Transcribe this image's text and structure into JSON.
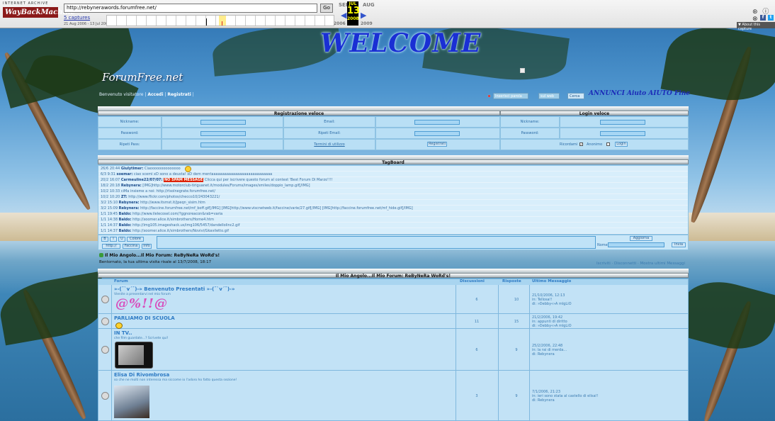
{
  "wayback": {
    "logo_top": "INTERNET ARCHIVE",
    "logo_main": "WayBackMachine",
    "url": "http://rebynerawords.forumfree.net/",
    "go": "Go",
    "captures": "5 captures",
    "date_range": "21 Aug 2006 - 13 Jul 2008",
    "month_prev": "SEP",
    "month_cur": "JUL",
    "month_next": "AUG",
    "day": "13",
    "year_prev": "2006",
    "year_cur": "2008",
    "year_next": "2009",
    "about": "▼ About this capture",
    "icons": "⊛ ⓘ ⊗"
  },
  "header": {
    "welcome": "WELCOME",
    "logo": "ForumFree.net",
    "welcome_line_prefix": "Benvenuto visitatore | ",
    "login_link": "Accedi",
    "register_link": "Registrati",
    "search_placeholder": "Inserisci parola",
    "search_scope": "sul web",
    "search_button": "Cerca",
    "right_links": "ANNUNCI   Aiuto   AIUTO   Fine"
  },
  "registration": {
    "title_left": "Registrazione veloce",
    "title_right": "Login veloce",
    "nickname": "Nickname:",
    "email": "Email:",
    "password": "Password:",
    "repeat_email": "Ripeti Email:",
    "repeat_pass": "Ripeti Pass:",
    "terms": "Termini di utilizzo",
    "register_btn": "Registrati",
    "login_nick": "Nickname:",
    "login_pass": "Password:",
    "remember": "Ricordami",
    "anonymous": "Anonimo",
    "login_btn": "Login"
  },
  "tagboard": {
    "title": "TagBoard",
    "rows": [
      {
        "time": "26/6 20:44",
        "user": "Giulytimer:",
        "text": "Ciaoooooooooooooo"
      },
      {
        "time": "6/3 9:31",
        "user": "soemar:",
        "text": "ciao scemi xD sono a deusta! xD dem mentaaaaaaaaaaaaaaaaaaaaaaaaaaaa"
      },
      {
        "time": "20/2 16:07",
        "user": "Carmeuline22/07/07:",
        "text": "Clicca qui per iscrivere questo forum al contest 'Best Forum Di Marzo'!!!",
        "spam": "NO SPAM MESSAGE"
      },
      {
        "time": "18/2 20:18",
        "user": "Rebynera:",
        "text": "[IMG]http://www.motorclub-tiriguanet.it/modules/Forums/images/smiles/doppio_lamp.gif[/IMG]"
      },
      {
        "time": "10/2 10:33",
        "user": "",
        "text": "ciMa insieme a noi: http://rlsolnegrate.forumfree.net/"
      },
      {
        "time": "10/2 10:20",
        "user": "ZT:",
        "text": "http://www.flickr.com/photos/checco10/243043221/"
      },
      {
        "time": "3/2 15:10",
        "user": "Rebynera:",
        "text": "http://www.itsmst.it/jpeqn_sisim.htm"
      },
      {
        "time": "3/2 15:09",
        "user": "Rebynera:",
        "text": "http://faccine.forumfree.net/mf_boff.gif[/IMG] [IMG]http://www.viscnetweb.it/faccine/varie/27.gif[/IMG] [IMG]http://faccine.forumfree.net/mf_hide.gif[/IMG]"
      },
      {
        "time": "1/1 19:45",
        "user": "Baldo:",
        "text": "http://www.ilelecosel.com/?ggnoreacon&rab=varia"
      },
      {
        "time": "1/1 14:38",
        "user": "Baldo:",
        "text": "http://xoomer.alice.it/simbrothers/Home4.htm"
      },
      {
        "time": "1/1 14:37",
        "user": "Baldo:",
        "text": "http://img105.imageshack.us/img106/5457/dandellolinc2.gif"
      },
      {
        "time": "1/1 14:37",
        "user": "Baldo:",
        "text": "http://xoomer.alice.it/simbrothers/Novivi/Gkaviletto.gif"
      }
    ],
    "tools": [
      "B",
      "I",
      "U",
      "Colore"
    ],
    "tools2": [
      "http://",
      "Faccina",
      "Info"
    ],
    "name_label": "Nome:",
    "update_btn": "Aggiorna",
    "send_btn": "Invia"
  },
  "board": {
    "title": "Il Mio Angolo...Il Mio Forum: ReByNeRa WoRd's!",
    "last_visit": "Bentornato, la tua ultima visita risale al 13/7/2008, 18:17",
    "right_links": "Iscriviti · Disconnetti · Mostra ultimi Messaggi",
    "section_title": "Il Mio Angolo...Il Mio Forum: ReByNeRa WoRd's!",
    "col_forum": "Forum",
    "col_discussions": "Discussioni",
    "col_replies": "Risposte",
    "col_last": "Ultimo Messaggio"
  },
  "forums": [
    {
      "title": "»-(¯`v´¯)-» Benvenuto Presentati »-(¯`v´¯)-»",
      "desc": "Vienite a presentarvi nel mio forum",
      "discussions": "6",
      "replies": "10",
      "last_date": "21/10/2006, 12:13",
      "last_in": "in: Tellosa!!",
      "last_by": "di: »Debby«»A mIgLiO"
    },
    {
      "title": "PARLIAMO DI SCUOLA",
      "desc": "",
      "discussions": "11",
      "replies": "15",
      "last_date": "21/2/2006, 19:42",
      "last_in": "in: appunti di diritto",
      "last_by": "di: »Debby«»A mIgLiO"
    },
    {
      "title": "IN TV..",
      "desc": "che film guardate...? Scrivete qui!",
      "discussions": "6",
      "replies": "9",
      "last_date": "25/2/2006, 22:48",
      "last_in": "in: la rai di merda...",
      "last_by": "di: Rebynera"
    },
    {
      "title": "Elisa Di Rivombrosa",
      "desc": "so che ne molti non interessa ma siccome io l'adoro ho fatto questa sezione!",
      "discussions": "3",
      "replies": "9",
      "last_date": "7/1/2006, 21:23",
      "last_in": "in: ieri sono stata al castello di elisa!!",
      "last_by": "di: Rebynera"
    }
  ],
  "colors": {
    "accent": "#2d7ac4",
    "cell": "#b9dff5",
    "header_grad": "#aeb8bf"
  }
}
